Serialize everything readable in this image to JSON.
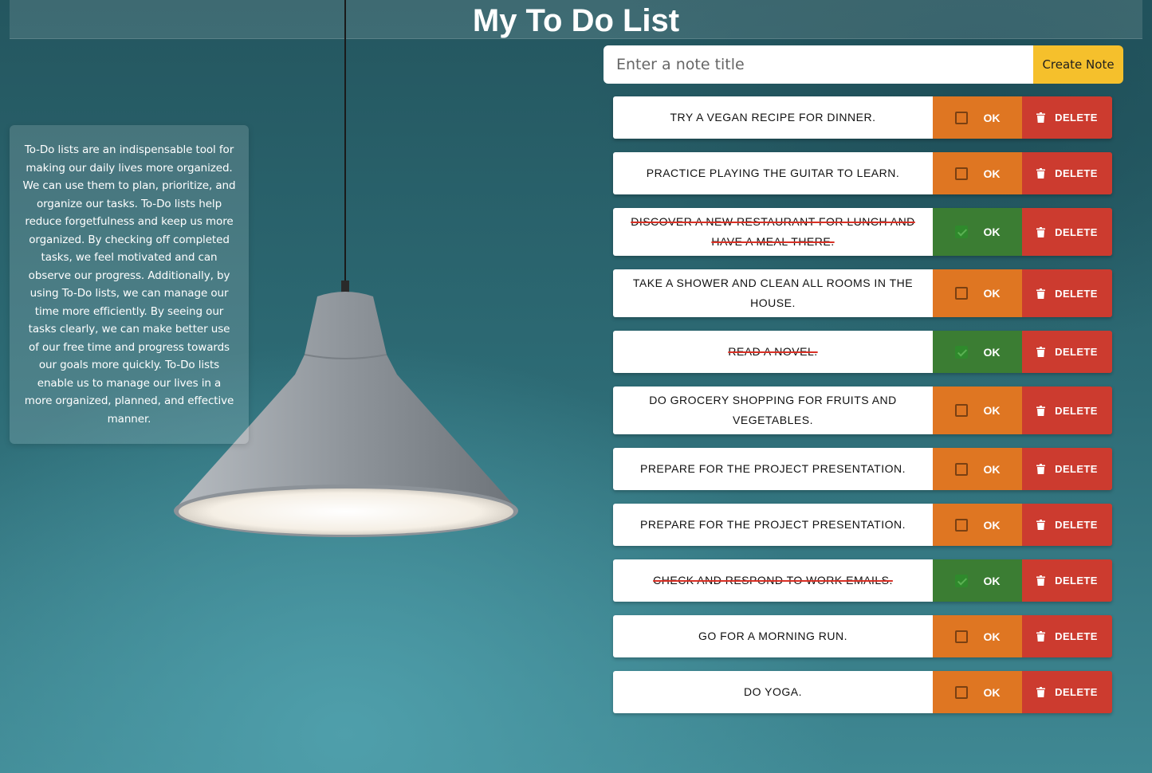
{
  "header": {
    "title": "My To Do List"
  },
  "info_card": {
    "text": "To-Do lists are an indispensable tool for making our daily lives more organized. We can use them to plan, prioritize, and organize our tasks. To-Do lists help reduce forgetfulness and keep us more organized. By checking off completed tasks, we feel motivated and can observe our progress. Additionally, by using To-Do lists, we can manage our time more efficiently. By seeing our tasks clearly, we can make better use of our free time and progress towards our goals more quickly. To-Do lists enable us to manage our lives in a more organized, planned, and effective manner."
  },
  "form": {
    "placeholder": "Enter a note title",
    "value": "",
    "create_label": "Create Note"
  },
  "task_buttons": {
    "ok_label": "OK",
    "delete_label": "DELETE"
  },
  "tasks": [
    {
      "text": "Try a vegan recipe for dinner.",
      "done": false
    },
    {
      "text": "Practice playing the guitar to learn.",
      "done": false
    },
    {
      "text": "Discover a new restaurant for lunch and have a meal there.",
      "done": true
    },
    {
      "text": "Take a shower and clean all rooms in the house.",
      "done": false
    },
    {
      "text": "Read a novel.",
      "done": true
    },
    {
      "text": "Do grocery shopping for fruits and vegetables.",
      "done": false
    },
    {
      "text": "Prepare for the project presentation.",
      "done": false
    },
    {
      "text": "Prepare for the project presentation.",
      "done": false
    },
    {
      "text": "Check and respond to work emails.",
      "done": true
    },
    {
      "text": "Go for a morning run.",
      "done": false
    },
    {
      "text": "Do yoga.",
      "done": false
    }
  ],
  "colors": {
    "ok_pending": "#df7622",
    "ok_done": "#3b7d33",
    "delete": "#cc3b2f",
    "create_button": "#f5c02c",
    "strike": "#d93025"
  },
  "icons": {
    "delete": "trash-icon",
    "ok": "checkbox-icon"
  }
}
